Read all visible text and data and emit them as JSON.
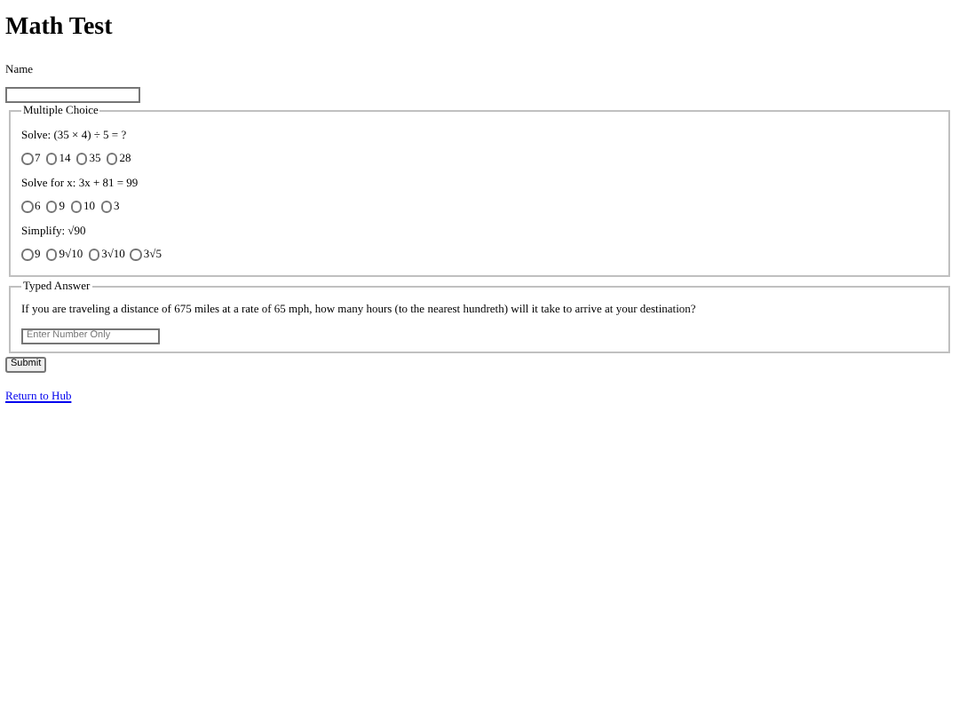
{
  "title": "Math Test",
  "name_field": {
    "label": "Name"
  },
  "multiple_choice": {
    "legend": "Multiple Choice",
    "questions": [
      {
        "prompt": "Solve: (35 × 4) ÷ 5 = ?",
        "options": [
          {
            "label": "7",
            "selected": false
          },
          {
            "label": "14",
            "selected": false
          },
          {
            "label": "35",
            "selected": false
          },
          {
            "label": "28",
            "selected": false
          }
        ]
      },
      {
        "prompt": "Solve for x: 3x + 81 = 99",
        "options": [
          {
            "label": "6",
            "selected": false
          },
          {
            "label": "9",
            "selected": false
          },
          {
            "label": "10",
            "selected": false
          },
          {
            "label": "3",
            "selected": false
          }
        ]
      },
      {
        "prompt": "Simplify: √90",
        "options": [
          {
            "label": "9",
            "selected": false
          },
          {
            "label": "9√10",
            "selected": false
          },
          {
            "label": "3√10",
            "selected": false
          },
          {
            "label": "3√5",
            "selected": false
          }
        ]
      }
    ]
  },
  "typed_answer": {
    "legend": "Typed Answer",
    "prompt": "If you are traveling a distance of 675 miles at a rate of 65 mph, how many hours (to the nearest hundreth) will it take to arrive at your destination?",
    "placeholder": "Enter Number Only"
  },
  "submit": "Submit",
  "link": "Return to Hub"
}
